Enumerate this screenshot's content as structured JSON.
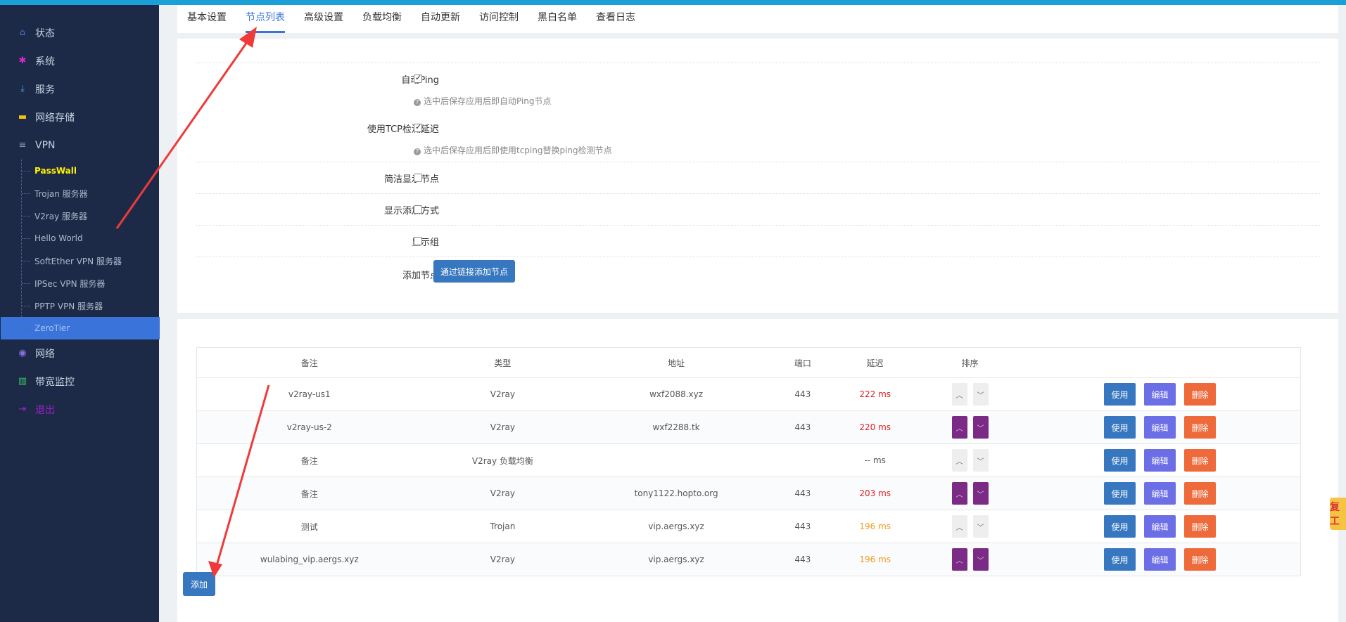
{
  "sidebar": {
    "items": [
      {
        "label": "状态",
        "icon": "home-icon",
        "color": "#4a78d0"
      },
      {
        "label": "系统",
        "icon": "gears-icon",
        "color": "#d42ad4"
      },
      {
        "label": "服务",
        "icon": "download-icon",
        "color": "#2fa9e6"
      },
      {
        "label": "网络存储",
        "icon": "hdd-icon",
        "color": "#f4c20d"
      },
      {
        "label": "VPN",
        "icon": "list-icon",
        "color": "#8a97b2"
      }
    ],
    "vpn_sub": [
      {
        "label": "PassWall"
      },
      {
        "label": "Trojan 服务器"
      },
      {
        "label": "V2ray 服务器"
      },
      {
        "label": "Hello World"
      },
      {
        "label": "SoftEther VPN 服务器"
      },
      {
        "label": "IPSec VPN 服务器"
      },
      {
        "label": "PPTP VPN 服务器"
      },
      {
        "label": "ZeroTier"
      }
    ],
    "bottom": [
      {
        "label": "网络",
        "icon": "globe-icon",
        "color": "#8a6de0"
      },
      {
        "label": "带宽监控",
        "icon": "bar-chart-icon",
        "color": "#3bc45e"
      },
      {
        "label": "退出",
        "icon": "logout-icon",
        "color": "#a020c8"
      }
    ]
  },
  "tabs": [
    "基本设置",
    "节点列表",
    "高级设置",
    "负载均衡",
    "自动更新",
    "访问控制",
    "黑白名单",
    "查看日志"
  ],
  "options": {
    "auto_ping": {
      "label": "自动Ping",
      "hint": "选中后保存应用后即自动Ping节点"
    },
    "tcp_delay": {
      "label": "使用TCP检测延迟",
      "hint": "选中后保存应用后即使用tcping替换ping检测节点"
    },
    "simple": {
      "label": "简洁显示节点"
    },
    "add_mode": {
      "label": "显示添加方式"
    },
    "group": {
      "label": "显示组"
    },
    "add_node": {
      "label": "添加节点",
      "button": "通过链接添加节点"
    }
  },
  "table": {
    "headers": {
      "remark": "备注",
      "type": "类型",
      "addr": "地址",
      "port": "端口",
      "delay": "延迟",
      "sort": "排序"
    },
    "rows": [
      {
        "remark": "v2ray-us1",
        "type": "V2ray",
        "addr": "wxf2088.xyz",
        "port": "443",
        "delay": "222 ms"
      },
      {
        "remark": "v2ray-us-2",
        "type": "V2ray",
        "addr": "wxf2288.tk",
        "port": "443",
        "delay": "220 ms"
      },
      {
        "remark": "备注",
        "type": "V2ray 负载均衡",
        "addr": "",
        "port": "",
        "delay": "-- ms"
      },
      {
        "remark": "备注",
        "type": "V2ray",
        "addr": "tony1122.hopto.org",
        "port": "443",
        "delay": "203 ms"
      },
      {
        "remark": "测试",
        "type": "Trojan",
        "addr": "vip.aergs.xyz",
        "port": "443",
        "delay": "196 ms"
      },
      {
        "remark": "wulabing_vip.aergs.xyz",
        "type": "V2ray",
        "addr": "vip.aergs.xyz",
        "port": "443",
        "delay": "196 ms"
      }
    ],
    "buttons": {
      "use": "使用",
      "edit": "编辑",
      "del": "删除"
    },
    "add_label": "添加"
  },
  "badge": "复工"
}
